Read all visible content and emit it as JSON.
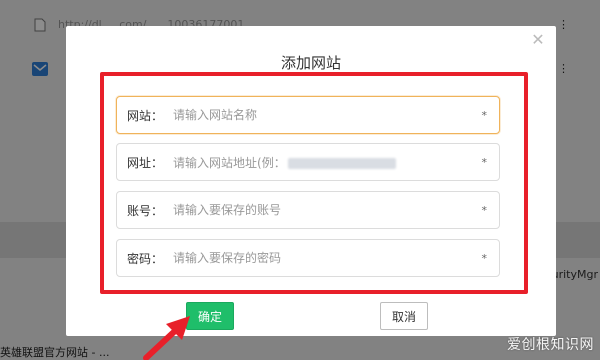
{
  "background": {
    "rows": [
      {
        "text": "http://dl.....com/.....   10036177001",
        "icon": "file-icon"
      },
      {
        "text": "",
        "icon": "mail-icon"
      }
    ],
    "right_fragment": "urityMgr",
    "bottom_tab": "英雄联盟官方网站 - ..."
  },
  "modal": {
    "title": "添加网站",
    "fields": [
      {
        "label": "网站：",
        "placeholder": "请输入网站名称",
        "required": "*"
      },
      {
        "label": "网址：",
        "placeholder": "请输入网站地址(例：",
        "required": "*"
      },
      {
        "label": "账号：",
        "placeholder": "请输入要保存的账号",
        "required": "*"
      },
      {
        "label": "密码：",
        "placeholder": "请输入要保存的密码",
        "required": "*"
      }
    ],
    "confirm_label": "确定",
    "cancel_label": "取消"
  },
  "watermark": "爱创根知识网",
  "colors": {
    "highlight": "#e8202a",
    "confirm": "#1fbe6a",
    "focus": "#f0b35a"
  }
}
